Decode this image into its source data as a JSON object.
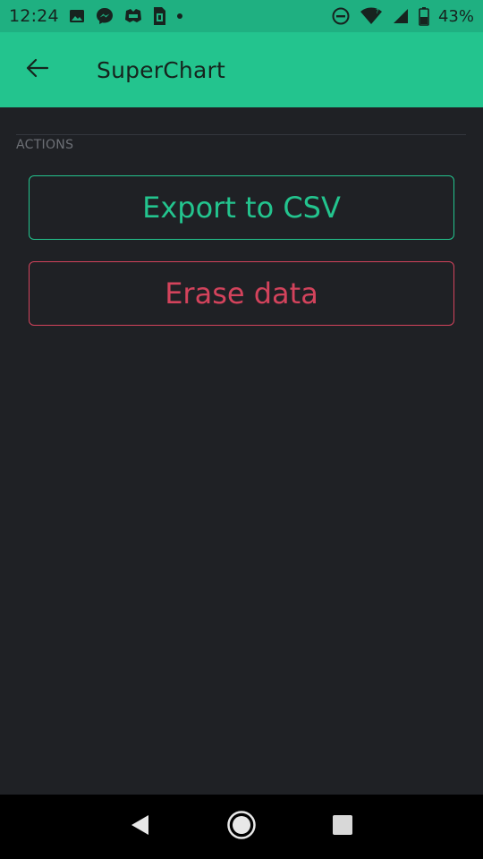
{
  "status_bar": {
    "time": "12:24",
    "battery": "43%",
    "left_icons": [
      "image-icon",
      "messenger-icon",
      "game-controller-icon",
      "sim-card-icon",
      "dot-icon"
    ],
    "right_icons": [
      "do-not-disturb-icon",
      "wifi-icon",
      "cell-signal-icon",
      "battery-icon"
    ]
  },
  "app_bar": {
    "title": "SuperChart",
    "back_icon": "arrow-left-icon"
  },
  "actions": {
    "section_label": "ACTIONS",
    "export_label": "Export to CSV",
    "erase_label": "Erase data"
  },
  "nav_bar": {
    "icons": [
      "back-triangle-icon",
      "home-circle-icon",
      "recents-square-icon"
    ]
  },
  "colors": {
    "status_bar": "#1fb081",
    "app_bar": "#23c48e",
    "background": "#1f2125",
    "accent_green": "#23c48e",
    "accent_red": "#d3435c"
  }
}
